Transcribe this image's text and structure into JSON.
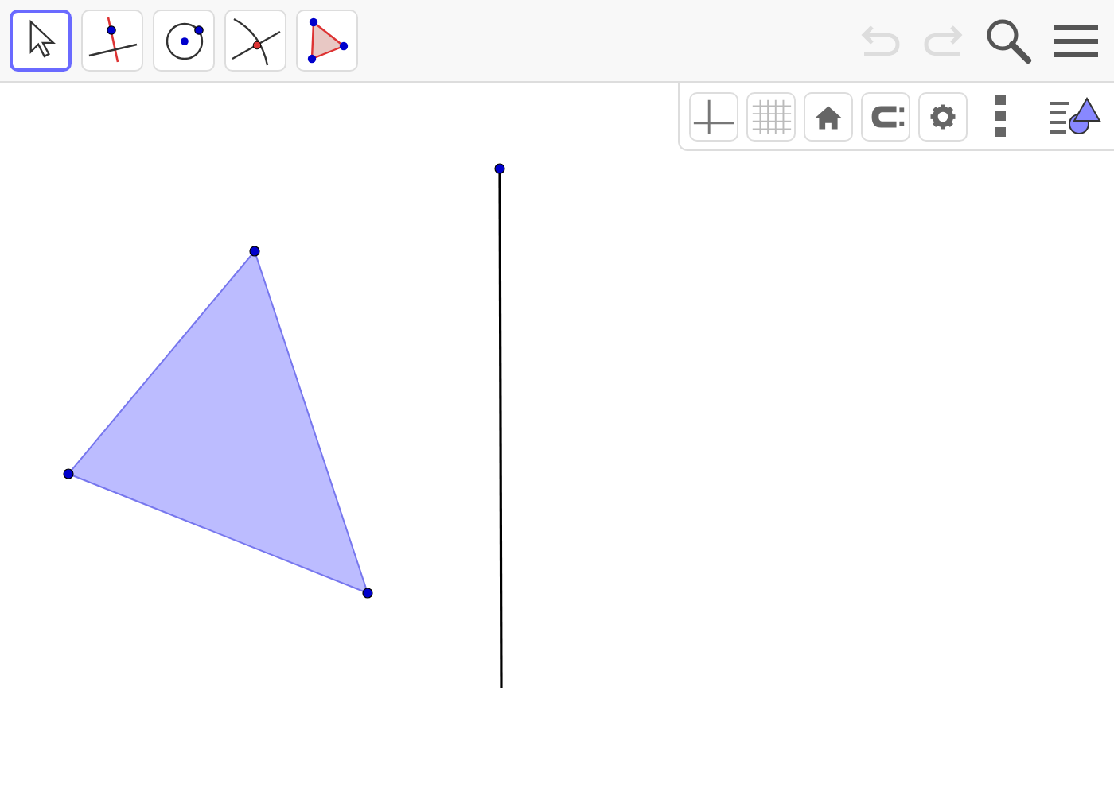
{
  "toolbar": {
    "tools": [
      {
        "kind": "move",
        "selected": true
      },
      {
        "kind": "perpendicular",
        "selected": false
      },
      {
        "kind": "circle",
        "selected": false
      },
      {
        "kind": "intersect",
        "selected": false
      },
      {
        "kind": "polygon",
        "selected": false
      }
    ]
  },
  "history": {
    "undo": {
      "disabled": true
    },
    "redo": {
      "disabled": true
    }
  },
  "style_bar": {
    "buttons": [
      {
        "kind": "axes"
      },
      {
        "kind": "grid"
      },
      {
        "kind": "home"
      },
      {
        "kind": "magnet"
      },
      {
        "kind": "settings"
      }
    ]
  }
}
